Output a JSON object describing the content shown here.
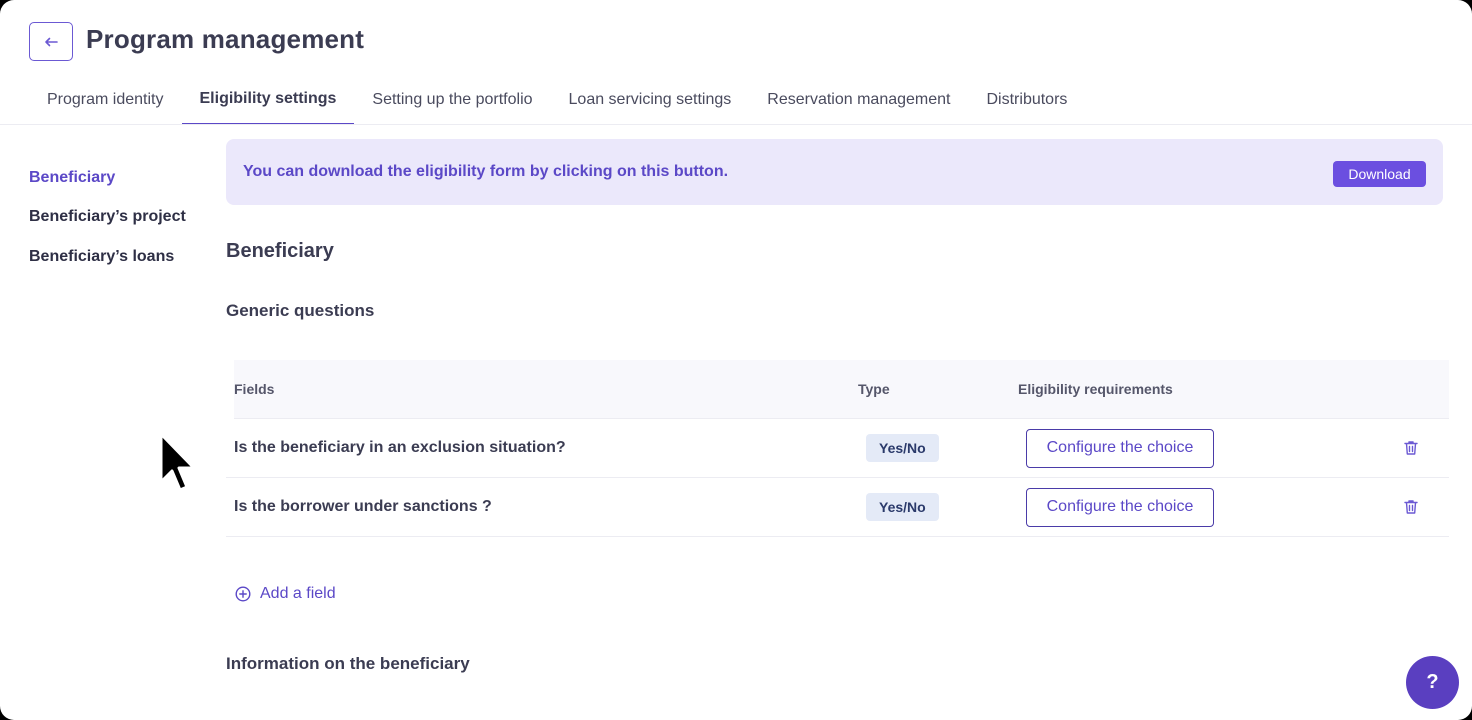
{
  "header": {
    "back_icon": "arrow-left-icon",
    "title": "Program management"
  },
  "tabs": [
    {
      "label": "Program identity",
      "active": false
    },
    {
      "label": "Eligibility settings",
      "active": true
    },
    {
      "label": "Setting up the portfolio",
      "active": false
    },
    {
      "label": "Loan servicing settings",
      "active": false
    },
    {
      "label": "Reservation management",
      "active": false
    },
    {
      "label": "Distributors",
      "active": false
    }
  ],
  "side_nav": [
    {
      "label": "Beneficiary",
      "active": true
    },
    {
      "label": "Beneficiary’s project",
      "active": false
    },
    {
      "label": "Beneficiary’s loans",
      "active": false
    }
  ],
  "banner": {
    "text": "You can download the eligibility form by clicking on this button.",
    "button_label": "Download"
  },
  "section": {
    "title": "Beneficiary",
    "subtitle": "Generic questions",
    "next_subtitle": "Information on the beneficiary"
  },
  "table": {
    "headers": {
      "fields": "Fields",
      "type": "Type",
      "eligibility": "Eligibility requirements"
    },
    "rows": [
      {
        "field": "Is the beneficiary in an exclusion situation?",
        "type": "Yes/No",
        "action": "Configure the choice"
      },
      {
        "field": "Is the borrower under sanctions ?",
        "type": "Yes/No",
        "action": "Configure the choice"
      }
    ]
  },
  "add_field": {
    "label": "Add a field",
    "icon": "plus-circle-icon"
  },
  "help": {
    "label": "?"
  },
  "colors": {
    "accent": "#5b48c7",
    "banner_bg": "#ebe8fb",
    "button": "#6b4fe0"
  }
}
